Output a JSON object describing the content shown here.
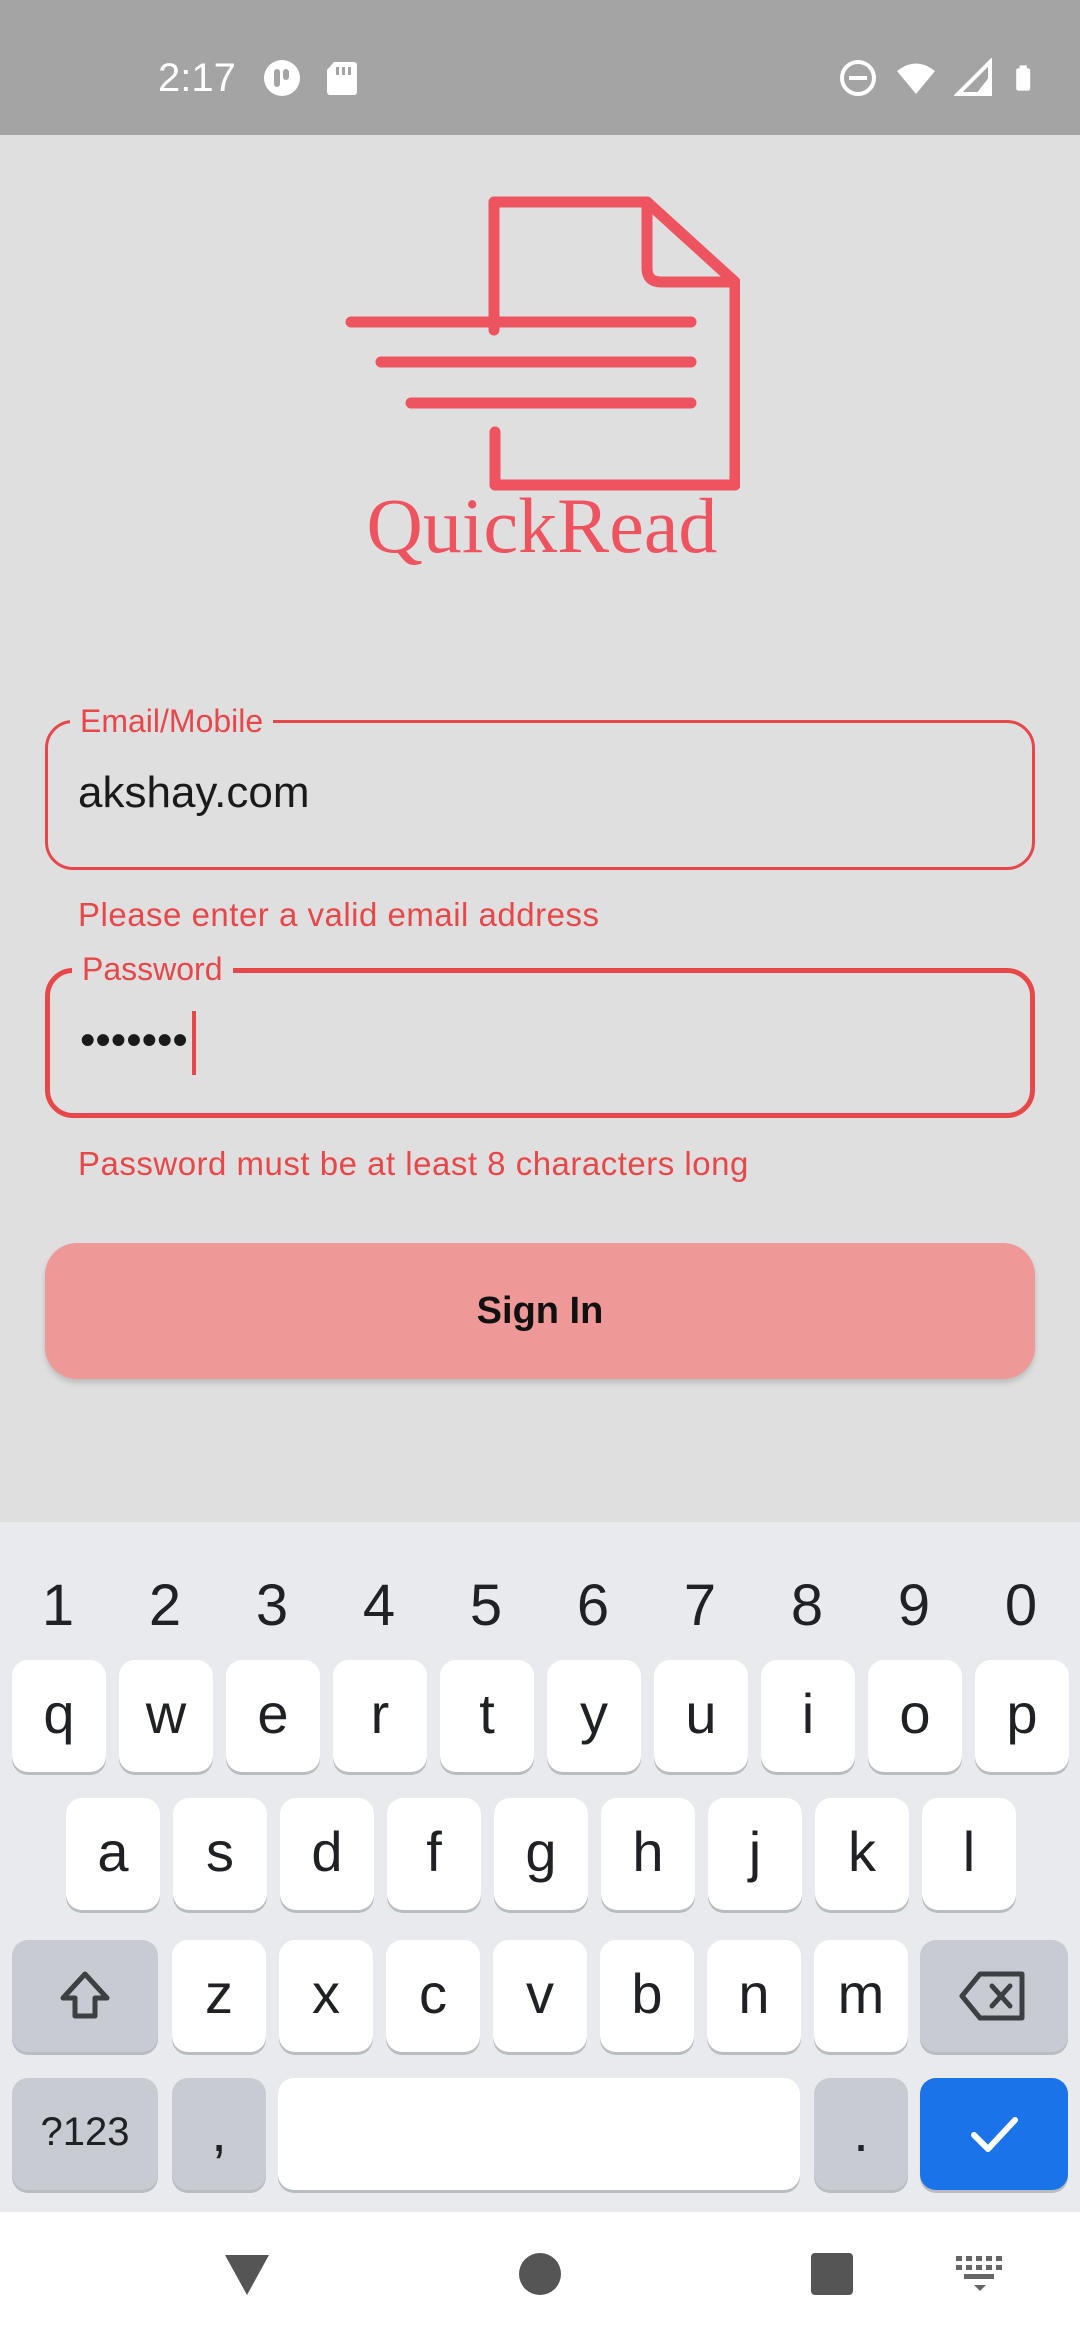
{
  "status_bar": {
    "time": "2:17",
    "left_icons": [
      "notification-app-icon",
      "sd-card-icon"
    ],
    "right_icons": [
      "do-not-disturb-icon",
      "wifi-icon",
      "signal-icon",
      "battery-icon"
    ]
  },
  "app": {
    "logo_text": "QuickRead",
    "brand_color": "#e8474a"
  },
  "form": {
    "email": {
      "label": "Email/Mobile",
      "value": "akshay.com",
      "error": "Please enter a valid email address"
    },
    "password": {
      "label": "Password",
      "value": "•••••••",
      "error": "Password must be at least 8 characters long"
    },
    "submit_label": "Sign In"
  },
  "keyboard": {
    "number_row": [
      "1",
      "2",
      "3",
      "4",
      "5",
      "6",
      "7",
      "8",
      "9",
      "0"
    ],
    "row1": [
      "q",
      "w",
      "e",
      "r",
      "t",
      "y",
      "u",
      "i",
      "o",
      "p"
    ],
    "row2": [
      "a",
      "s",
      "d",
      "f",
      "g",
      "h",
      "j",
      "k",
      "l"
    ],
    "row3": [
      "z",
      "x",
      "c",
      "v",
      "b",
      "n",
      "m"
    ],
    "symbols_label": "?123",
    "comma": ",",
    "period": ".",
    "accent_color": "#1a73e8"
  },
  "nav_bar": {
    "icons": [
      "back-icon",
      "home-icon",
      "recents-icon",
      "keyboard-switch-icon"
    ]
  }
}
